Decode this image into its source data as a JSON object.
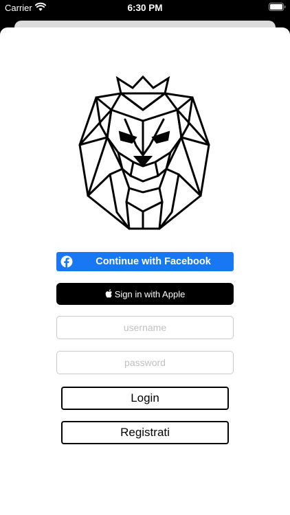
{
  "status_bar": {
    "carrier": "Carrier",
    "time": "6:30 PM",
    "wifi_icon": "wifi-icon",
    "battery_icon": "battery-full-icon"
  },
  "logo": {
    "icon": "crowned-lion-head-logo"
  },
  "facebook": {
    "label": "Continue with Facebook",
    "icon": "facebook-icon",
    "color": "#1877f2"
  },
  "apple": {
    "label": "Sign in with Apple",
    "icon": "apple-icon",
    "color": "#000000"
  },
  "form": {
    "username_placeholder": "username",
    "username_value": "",
    "password_placeholder": "password",
    "password_value": ""
  },
  "actions": {
    "login_label": "Login",
    "register_label": "Registrati"
  }
}
